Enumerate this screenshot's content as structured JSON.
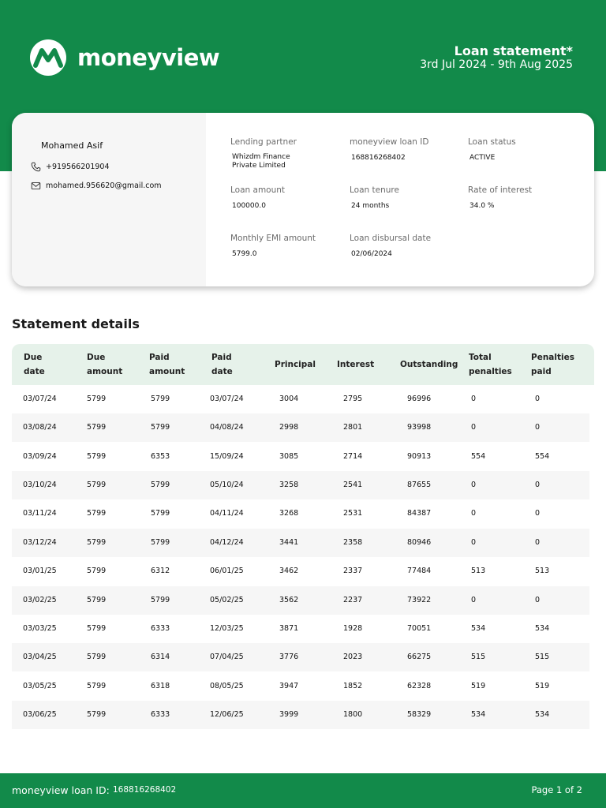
{
  "brand": {
    "name": "moneyview",
    "logo_icon": "moneyview-m-logo-icon"
  },
  "statement": {
    "title": "Loan statement*",
    "range": "3rd Jul 2024 - 9th Aug 2025"
  },
  "customer": {
    "name": "Mohamed Asif",
    "phone": "+919566201904",
    "email": "mohamed.956620@gmail.com",
    "phone_icon": "phone-icon",
    "email_icon": "mail-icon"
  },
  "loan": {
    "lending_partner_label": "Lending partner",
    "lending_partner_value_line1": "Whizdm Finance",
    "lending_partner_value_line2": "Private Limited",
    "loan_id_label": "moneyview loan ID",
    "loan_id_value": "168816268402",
    "status_label": "Loan status",
    "status_value": "ACTIVE",
    "amount_label": "Loan amount",
    "amount_value": "100000.0",
    "tenure_label": "Loan tenure",
    "tenure_value": "24 months",
    "rate_label": "Rate of interest",
    "rate_value": "34.0 %",
    "emi_label": "Monthly EMI amount",
    "emi_value": "5799.0",
    "disbursal_label": "Loan disbursal date",
    "disbursal_value": "02/06/2024"
  },
  "section_title": "Statement details",
  "table": {
    "headers": [
      [
        "Due",
        "date"
      ],
      [
        "Due",
        "amount"
      ],
      [
        "Paid",
        "amount"
      ],
      [
        "Paid",
        "date"
      ],
      [
        "Principal"
      ],
      [
        "Interest"
      ],
      [
        "Outstanding"
      ],
      [
        "Total",
        "penalties"
      ],
      [
        "Penalties",
        "paid"
      ]
    ],
    "rows": [
      [
        "03/07/24",
        "5799",
        "5799",
        "03/07/24",
        "3004",
        "2795",
        "96996",
        "0",
        "0"
      ],
      [
        "03/08/24",
        "5799",
        "5799",
        "04/08/24",
        "2998",
        "2801",
        "93998",
        "0",
        "0"
      ],
      [
        "03/09/24",
        "5799",
        "6353",
        "15/09/24",
        "3085",
        "2714",
        "90913",
        "554",
        "554"
      ],
      [
        "03/10/24",
        "5799",
        "5799",
        "05/10/24",
        "3258",
        "2541",
        "87655",
        "0",
        "0"
      ],
      [
        "03/11/24",
        "5799",
        "5799",
        "04/11/24",
        "3268",
        "2531",
        "84387",
        "0",
        "0"
      ],
      [
        "03/12/24",
        "5799",
        "5799",
        "04/12/24",
        "3441",
        "2358",
        "80946",
        "0",
        "0"
      ],
      [
        "03/01/25",
        "5799",
        "6312",
        "06/01/25",
        "3462",
        "2337",
        "77484",
        "513",
        "513"
      ],
      [
        "03/02/25",
        "5799",
        "5799",
        "05/02/25",
        "3562",
        "2237",
        "73922",
        "0",
        "0"
      ],
      [
        "03/03/25",
        "5799",
        "6333",
        "12/03/25",
        "3871",
        "1928",
        "70051",
        "534",
        "534"
      ],
      [
        "03/04/25",
        "5799",
        "6314",
        "07/04/25",
        "3776",
        "2023",
        "66275",
        "515",
        "515"
      ],
      [
        "03/05/25",
        "5799",
        "6318",
        "08/05/25",
        "3947",
        "1852",
        "62328",
        "519",
        "519"
      ],
      [
        "03/06/25",
        "5799",
        "6333",
        "12/06/25",
        "3999",
        "1800",
        "58329",
        "534",
        "534"
      ]
    ]
  },
  "footer": {
    "loan_id_label": "moneyview loan ID:",
    "loan_id_value": "168816268402",
    "page": "Page 1 of 2"
  },
  "colors": {
    "brand_green": "#128a4a",
    "header_row": "#e6f2ea",
    "alt_row": "#f6f6f6"
  }
}
